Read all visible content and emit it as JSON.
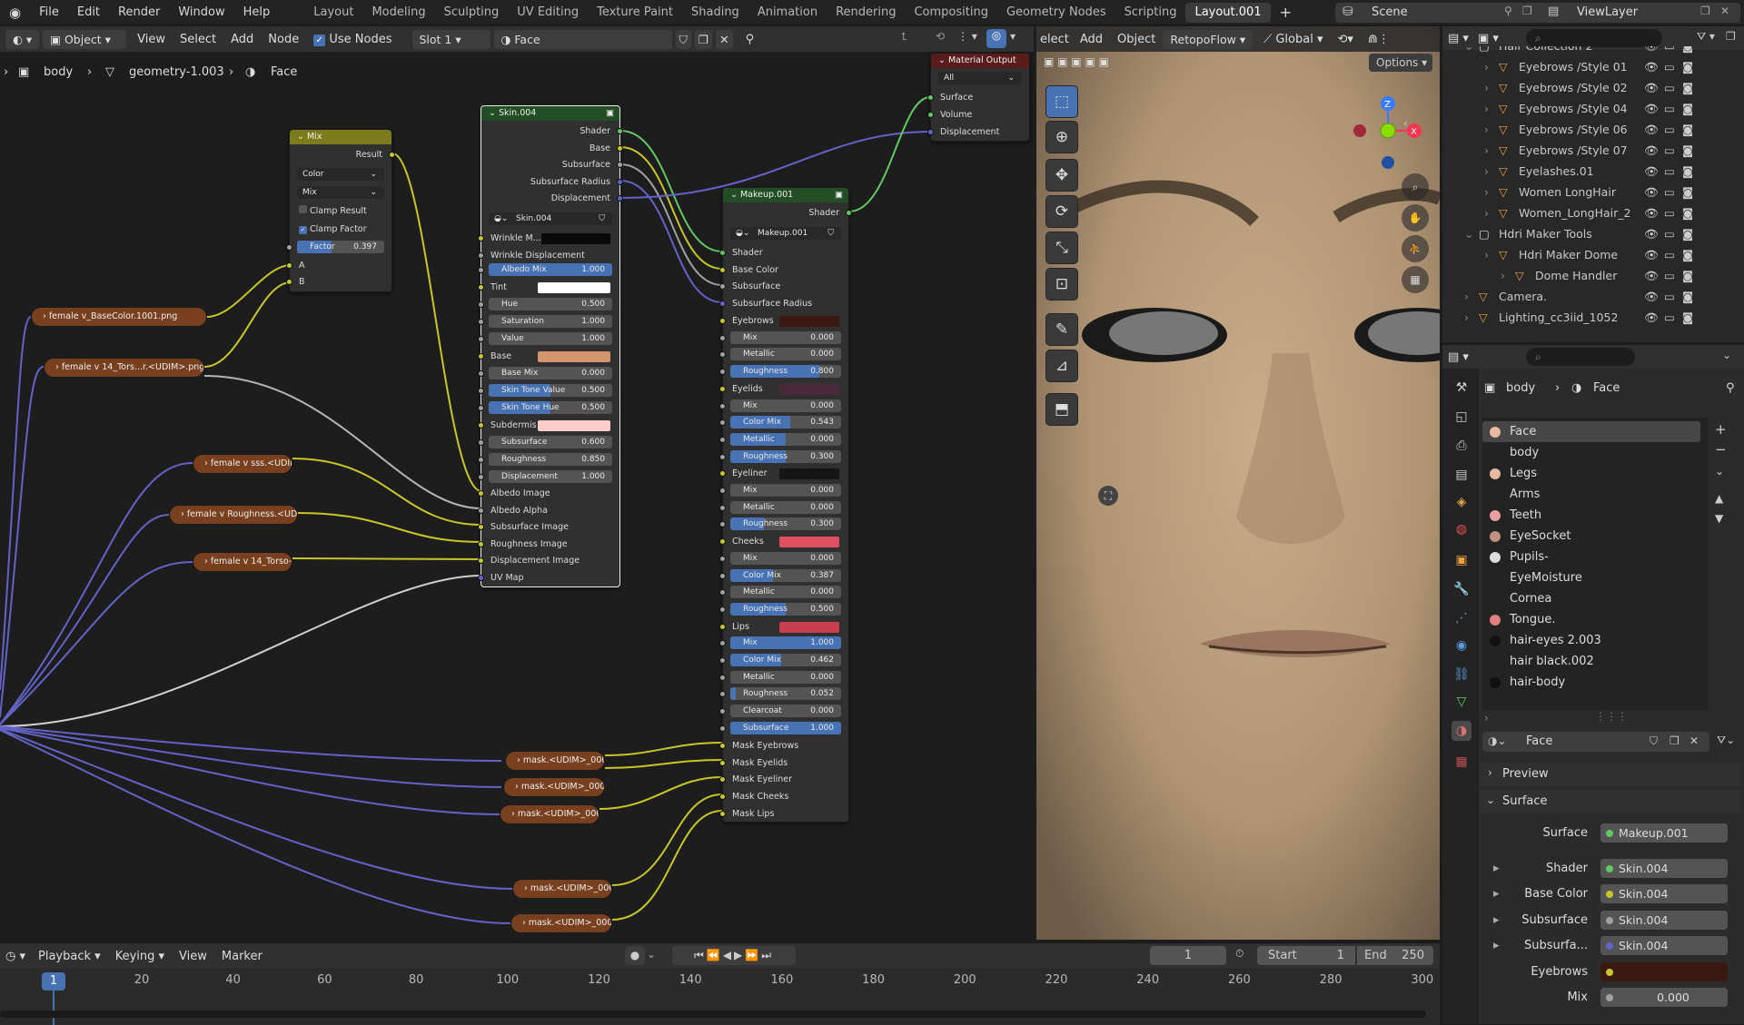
{
  "menu": [
    "File",
    "Edit",
    "Render",
    "Window",
    "Help"
  ],
  "workspaces": [
    "Layout",
    "Modeling",
    "Sculpting",
    "UV Editing",
    "Texture Paint",
    "Shading",
    "Animation",
    "Rendering",
    "Compositing",
    "Geometry Nodes",
    "Scripting",
    "Layout.001"
  ],
  "scene": "Scene",
  "viewlayer": "ViewLayer",
  "node_header": {
    "mode": "Object",
    "view": "View",
    "select": "Select",
    "add": "Add",
    "node": "Node",
    "use_nodes": "Use Nodes",
    "slot": "Slot 1",
    "material": "Face"
  },
  "breadcrumb": {
    "obj": "body",
    "mesh": "geometry-1.003",
    "mat": "Face"
  },
  "viewport_header": {
    "select": "elect",
    "add": "Add",
    "object": "Object",
    "retopo": "RetopoFlow",
    "orient": "Global",
    "options": "Options"
  },
  "nodes": {
    "mix": {
      "title": "Mix",
      "result": "Result",
      "type": "Color",
      "blend": "Mix",
      "clamp_result": "Clamp Result",
      "clamp_factor": "Clamp Factor",
      "factor_label": "Factor",
      "factor": "0.397",
      "a": "A",
      "b": "B"
    },
    "skin": {
      "title": "Skin.004",
      "outputs": [
        "Shader",
        "Base",
        "Subsurface",
        "Subsurface Radius",
        "Displacement"
      ],
      "group": "Skin.004",
      "wrinkle_m": "Wrinkle M...",
      "wrinkle_disp": "Wrinkle Displacement",
      "fields": [
        {
          "label": "Albedo Mix",
          "value": "1.000",
          "fill": 1.0
        },
        {
          "label": "Tint",
          "value": "",
          "color": "#ffffff"
        },
        {
          "label": "Hue",
          "value": "0.500",
          "fill": 0
        },
        {
          "label": "Saturation",
          "value": "1.000",
          "fill": 0
        },
        {
          "label": "Value",
          "value": "1.000",
          "fill": 0
        },
        {
          "label": "Base",
          "value": "",
          "color": "#d4956d"
        },
        {
          "label": "Base Mix",
          "value": "0.000",
          "fill": 0
        },
        {
          "label": "Skin Tone Value",
          "value": "0.500",
          "fill": 0.5
        },
        {
          "label": "Skin Tone Hue",
          "value": "0.500",
          "fill": 0.5
        },
        {
          "label": "Subdermis",
          "value": "",
          "color": "#ffcccc"
        },
        {
          "label": "Subsurface",
          "value": "0.600",
          "fill": 0
        },
        {
          "label": "Roughness",
          "value": "0.850",
          "fill": 0
        },
        {
          "label": "Displacement",
          "value": "1.000",
          "fill": 0
        }
      ],
      "inputs": [
        "Albedo Image",
        "Albedo Alpha",
        "Subsurface Image",
        "Roughness Image",
        "Displacement Image",
        "UV Map"
      ]
    },
    "makeup": {
      "title": "Makeup.001",
      "output": "Shader",
      "group": "Makeup.001",
      "inputs_top": [
        "Shader",
        "Base Color",
        "Subsurface",
        "Subsurface Radius"
      ],
      "fields": [
        {
          "label": "Eyebrows",
          "value": "",
          "color": "#3a1a10"
        },
        {
          "label": "Mix",
          "value": "0.000",
          "fill": 0
        },
        {
          "label": "Metallic",
          "value": "0.000",
          "fill": 0
        },
        {
          "label": "Roughness",
          "value": "0.800",
          "fill": 0.8
        },
        {
          "label": "Eyelids",
          "value": "",
          "color": "#4a2a3a"
        },
        {
          "label": "Mix",
          "value": "0.000",
          "fill": 0
        },
        {
          "label": "Color Mix",
          "value": "0.543",
          "fill": 0.543
        },
        {
          "label": "Metallic",
          "value": "0.000",
          "fill": 0.5
        },
        {
          "label": "Roughness",
          "value": "0.300",
          "fill": 0.5
        },
        {
          "label": "Eyeliner",
          "value": "",
          "color": "#151515"
        },
        {
          "label": "Mix",
          "value": "0.000",
          "fill": 0
        },
        {
          "label": "Metallic",
          "value": "0.000",
          "fill": 0
        },
        {
          "label": "Roughness",
          "value": "0.300",
          "fill": 0.3
        },
        {
          "label": "Cheeks",
          "value": "",
          "color": "#e05060"
        },
        {
          "label": "Mix",
          "value": "0.000",
          "fill": 0
        },
        {
          "label": "Color Mix",
          "value": "0.387",
          "fill": 0.387
        },
        {
          "label": "Metallic",
          "value": "0.000",
          "fill": 0
        },
        {
          "label": "Roughness",
          "value": "0.500",
          "fill": 0.5
        },
        {
          "label": "Lips",
          "value": "",
          "color": "#c84050"
        },
        {
          "label": "Mix",
          "value": "1.000",
          "fill": 1.0
        },
        {
          "label": "Color Mix",
          "value": "0.462",
          "fill": 0.462
        },
        {
          "label": "Metallic",
          "value": "0.000",
          "fill": 0
        },
        {
          "label": "Roughness",
          "value": "0.052",
          "fill": 0.052
        },
        {
          "label": "Clearcoat",
          "value": "0.000",
          "fill": 0
        },
        {
          "label": "Subsurface",
          "value": "1.000",
          "fill": 1.0
        }
      ],
      "masks": [
        "Mask Eyebrows",
        "Mask Eyelids",
        "Mask Eyeliner",
        "Mask Cheeks",
        "Mask Lips"
      ]
    },
    "output": {
      "title": "Material Output",
      "target": "All",
      "sockets": [
        "Surface",
        "Volume",
        "Displacement"
      ]
    },
    "images": [
      "female v_BaseColor.1001.png",
      "female v 14_Tors...r.<UDIM>.png.003",
      "female v sss.<UDIM...",
      "female v Roughness.<UDI...",
      "female v 14_Torso-...",
      "mask.<UDIM>_000...",
      "mask.<UDIM>_000...",
      "mask.<UDIM>_000...",
      "mask.<UDIM>_000...",
      "mask.<UDIM>_000..."
    ]
  },
  "outliner": [
    {
      "label": "Hair Collection 2",
      "type": "collection"
    },
    {
      "label": "Eyebrows /Style 01",
      "type": "obj"
    },
    {
      "label": "Eyebrows /Style 02",
      "type": "obj"
    },
    {
      "label": "Eyebrows /Style 04",
      "type": "obj"
    },
    {
      "label": "Eyebrows /Style 06",
      "type": "obj"
    },
    {
      "label": "Eyebrows /Style 07",
      "type": "obj"
    },
    {
      "label": "Eyelashes.01",
      "type": "obj"
    },
    {
      "label": "Women LongHair",
      "type": "obj"
    },
    {
      "label": "Women_LongHair_2",
      "type": "obj"
    },
    {
      "label": "Hdri Maker Tools",
      "type": "collection"
    },
    {
      "label": "Hdri Maker Dome",
      "type": "obj"
    },
    {
      "label": "Dome Handler",
      "type": "obj"
    },
    {
      "label": "Camera.",
      "type": "obj"
    },
    {
      "label": "Lighting_cc3iid_1052",
      "type": "obj"
    }
  ],
  "properties": {
    "breadcrumb": {
      "obj": "body",
      "mat": "Face"
    },
    "materials": [
      {
        "name": "Face",
        "color": "#e8b8a0"
      },
      {
        "name": "body",
        "color": ""
      },
      {
        "name": "Legs",
        "color": "#e8b8a0"
      },
      {
        "name": "Arms",
        "color": ""
      },
      {
        "name": "Teeth",
        "color": "#e8a0a0"
      },
      {
        "name": "EyeSocket",
        "color": "#c09080"
      },
      {
        "name": "Pupils-",
        "color": "#dddddd"
      },
      {
        "name": "EyeMoisture",
        "color": ""
      },
      {
        "name": "Cornea",
        "color": ""
      },
      {
        "name": "Tongue.",
        "color": "#e08080"
      },
      {
        "name": "hair-eyes 2.003",
        "color": "#111111"
      },
      {
        "name": "hair black.002",
        "color": "#222222"
      },
      {
        "name": "hair-body",
        "color": "#111111"
      }
    ],
    "material_name": "Face",
    "preview": "Preview",
    "surface_panel": "Surface",
    "rows": [
      {
        "label": "Surface",
        "value": "Makeup.001",
        "sock": "#63c763"
      },
      {
        "label": "Shader",
        "value": "Skin.004",
        "sock": "#63c763"
      },
      {
        "label": "Base Color",
        "value": "Skin.004",
        "sock": "#c7c729"
      },
      {
        "label": "Subsurface",
        "value": "Skin.004",
        "sock": "#a1a1a1"
      },
      {
        "label": "Subsurfa...",
        "value": "Skin.004",
        "sock": "#6363c7"
      },
      {
        "label": "Eyebrows",
        "value": "",
        "sock": "#c7c729",
        "color": "#3a1a10"
      },
      {
        "label": "Mix",
        "value": "0.000",
        "sock": "#a1a1a1"
      }
    ]
  },
  "timeline": {
    "playback": "Playback",
    "keying": "Keying",
    "view": "View",
    "marker": "Marker",
    "current": "1",
    "start_label": "Start",
    "start": "1",
    "end_label": "End",
    "end": "250",
    "frame_marker": "1",
    "ticks": [
      "20",
      "40",
      "60",
      "80",
      "100",
      "120",
      "140",
      "160",
      "180",
      "200",
      "220",
      "240",
      "260",
      "280",
      "300"
    ]
  }
}
